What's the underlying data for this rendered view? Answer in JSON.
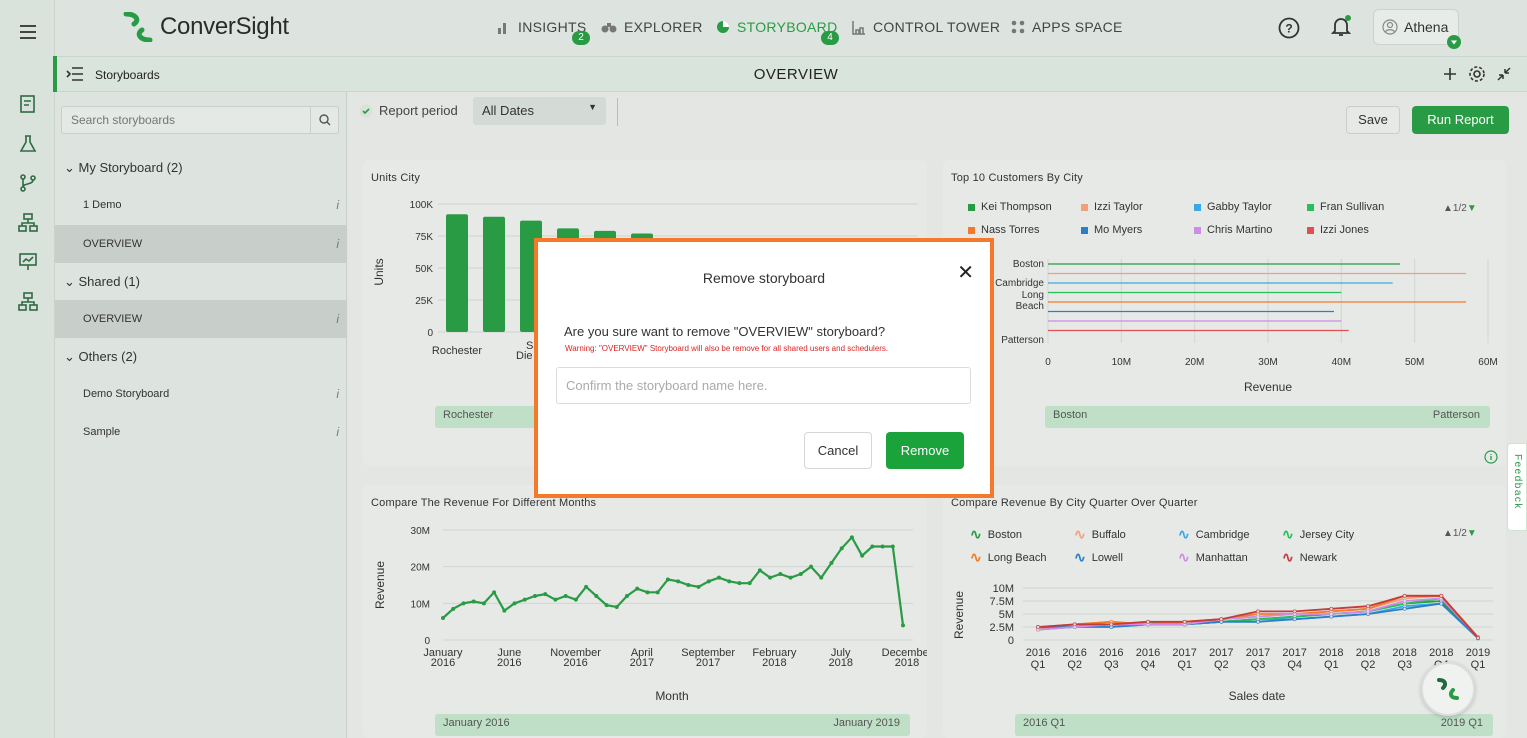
{
  "app": {
    "name": "ConverSight"
  },
  "nav": [
    {
      "label": "INSIGHTS",
      "badge": "2"
    },
    {
      "label": "EXPLORER",
      "badge": ""
    },
    {
      "label": "STORYBOARD",
      "badge": "4"
    },
    {
      "label": "CONTROL TOWER",
      "badge": ""
    },
    {
      "label": "APPS SPACE",
      "badge": ""
    }
  ],
  "user": {
    "name": "Athena"
  },
  "subheader": {
    "section": "Storyboards",
    "title": "OVERVIEW"
  },
  "sidebar": {
    "search_placeholder": "Search storyboards",
    "groups": [
      {
        "label": "My Storyboard (2)",
        "items": [
          "1 Demo",
          "OVERVIEW"
        ]
      },
      {
        "label": "Shared (1)",
        "items": [
          "OVERVIEW"
        ]
      },
      {
        "label": "Others (2)",
        "items": [
          "Demo Storyboard",
          "Sample"
        ]
      }
    ]
  },
  "toolbar": {
    "report_period_label": "Report period",
    "dates_value": "All Dates",
    "save_label": "Save",
    "run_label": "Run Report"
  },
  "colors": {
    "accent": "#2a9b45",
    "modal_border": "#f47a2a",
    "warning": "#dd2222"
  },
  "panels": {
    "units_city": {
      "title": "Units City",
      "scroll_start": "Rochester"
    },
    "top_customers": {
      "title": "Top 10 Customers By City",
      "pager": "1/2",
      "scroll_start": "Boston",
      "scroll_end": "Patterson"
    },
    "revenue_months": {
      "title": "Compare The Revenue For Different Months",
      "scroll_start": "January 2016",
      "scroll_end": "January 2019"
    },
    "revenue_quarter": {
      "title": "Compare Revenue By City Quarter Over Quarter",
      "pager": "1/2",
      "scroll_start": "2016 Q1",
      "scroll_end": "2019 Q1"
    }
  },
  "modal": {
    "title": "Remove storyboard",
    "question": "Are you sure want to remove \"OVERVIEW\" storyboard?",
    "warning": "Warning: \"OVERVIEW\" Storyboard will also be remove for all shared users and schedulers.",
    "input_placeholder": "Confirm the storyboard name here.",
    "cancel_label": "Cancel",
    "remove_label": "Remove"
  },
  "feedback_label": "Feedback",
  "chart_data": [
    {
      "type": "bar",
      "title": "Units City",
      "ylabel": "Units",
      "ylim": [
        0,
        100000
      ],
      "yticks": [
        "100K",
        "75K",
        "50K",
        "25K",
        "0"
      ],
      "categories": [
        "Rochester",
        "Sa... Die...",
        "",
        "",
        "",
        ""
      ],
      "visible_tick_labels": [
        "Rochester",
        "Sa",
        "Die"
      ],
      "values": [
        92000,
        90000,
        87000,
        81000,
        79000,
        77000
      ]
    },
    {
      "type": "bar",
      "title": "Top 10 Customers By City",
      "xlabel": "Revenue",
      "xticks": [
        "0",
        "10M",
        "20M",
        "30M",
        "40M",
        "50M",
        "60M"
      ],
      "categories": [
        "Boston",
        "Cambridge",
        "Long Beach",
        "Patterson"
      ],
      "legend": [
        "Kei Thompson",
        "Izzi Taylor",
        "Gabby Taylor",
        "Fran Sullivan",
        "Nass Torres",
        "Mo Myers",
        "Chris Martino",
        "Izzi Jones"
      ],
      "legend_colors": [
        "#2a9b45",
        "#f2a07b",
        "#3aa8e8",
        "#25c05a",
        "#f47a2a",
        "#2a7fc8",
        "#d08ae8",
        "#e05050"
      ],
      "series": [
        {
          "name": "Kei Thompson",
          "values": [
            48
          ]
        },
        {
          "name": "Izzi Taylor",
          "values": [
            57
          ]
        },
        {
          "name": "Gabby Taylor",
          "values": [
            47
          ]
        },
        {
          "name": "Fran Sullivan",
          "values": [
            40
          ]
        },
        {
          "name": "Nass Torres",
          "values": [
            57
          ]
        },
        {
          "name": "Mo Myers",
          "values": [
            39
          ]
        },
        {
          "name": "Chris Martino",
          "values": [
            40
          ]
        },
        {
          "name": "Izzi Jones",
          "values": [
            41
          ]
        }
      ]
    },
    {
      "type": "line",
      "title": "Compare The Revenue For Different Months",
      "xlabel": "Month",
      "ylabel": "Revenue",
      "ylim": [
        0,
        30
      ],
      "yticks": [
        "30M",
        "20M",
        "10M",
        "0"
      ],
      "xticks": [
        "January 2016",
        "June 2016",
        "November 2016",
        "April 2017",
        "September 2017",
        "February 2018",
        "July 2018",
        "December 2018"
      ],
      "values": [
        6,
        8.5,
        10,
        10.5,
        10,
        13,
        8,
        10,
        11,
        12,
        12.5,
        11,
        12,
        11,
        14.5,
        12,
        9.5,
        9,
        12,
        14,
        13,
        13,
        16.5,
        16,
        15,
        14.5,
        16,
        17,
        16,
        15.5,
        15.5,
        19,
        17,
        18,
        17,
        18,
        20,
        17,
        21,
        25,
        28,
        23,
        25.5,
        25.5,
        25.5,
        4
      ]
    },
    {
      "type": "line",
      "title": "Compare Revenue By City Quarter Over Quarter",
      "xlabel": "Sales date",
      "ylabel": "Revenue",
      "ylim": [
        0,
        10
      ],
      "yticks": [
        "10M",
        "7.5M",
        "5M",
        "2.5M",
        "0"
      ],
      "x": [
        "2016 Q1",
        "2016 Q2",
        "2016 Q3",
        "2016 Q4",
        "2017 Q1",
        "2017 Q2",
        "2017 Q3",
        "2017 Q4",
        "2018 Q1",
        "2018 Q2",
        "2018 Q3",
        "2018 Q4",
        "2019 Q1"
      ],
      "series": [
        {
          "name": "Boston",
          "color": "#2a9b45",
          "values": [
            2,
            2.5,
            3,
            3,
            3,
            3.5,
            4,
            4.5,
            5,
            5.5,
            7,
            7.5,
            0.5
          ]
        },
        {
          "name": "Buffalo",
          "color": "#f2a07b",
          "values": [
            2.5,
            3,
            3.5,
            3,
            3.5,
            4,
            4.5,
            5,
            5.5,
            6,
            8,
            8.5,
            0.5
          ]
        },
        {
          "name": "Cambridge",
          "color": "#3aa8e8",
          "values": [
            2,
            3,
            2.5,
            3,
            3,
            3.5,
            4,
            4,
            4.5,
            5,
            6.5,
            7,
            0.3
          ]
        },
        {
          "name": "Jersey City",
          "color": "#25c05a",
          "values": [
            2.5,
            2.5,
            3,
            3.5,
            3,
            3.5,
            4,
            4.5,
            5,
            5.5,
            7,
            8,
            0.5
          ]
        },
        {
          "name": "Long Beach",
          "color": "#f47a2a",
          "values": [
            2,
            3,
            3.5,
            3,
            3.5,
            4,
            5,
            5,
            5.5,
            6,
            8.5,
            8.5,
            0.6
          ]
        },
        {
          "name": "Lowell",
          "color": "#2a7fc8",
          "values": [
            2.5,
            2.5,
            2.5,
            3,
            3,
            3.5,
            3.5,
            4,
            4.5,
            5,
            6,
            7,
            0.4
          ]
        },
        {
          "name": "Manhattan",
          "color": "#d08ae8",
          "values": [
            2,
            2.5,
            3,
            3,
            3,
            4,
            4.5,
            5,
            5,
            5.5,
            7.5,
            8,
            0.5
          ]
        },
        {
          "name": "Newark",
          "color": "#c43b3b",
          "values": [
            2.5,
            3,
            3,
            3.5,
            3.5,
            4,
            5.5,
            5.5,
            6,
            6.5,
            8.5,
            8.5,
            0.4
          ]
        }
      ]
    }
  ]
}
